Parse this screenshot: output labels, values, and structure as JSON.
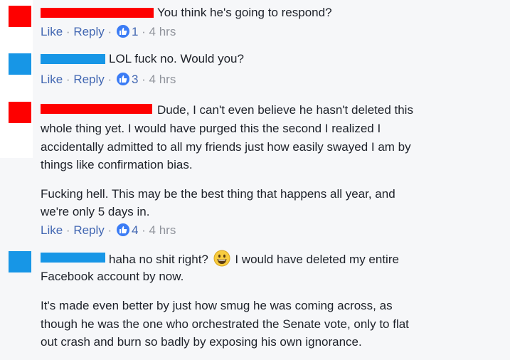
{
  "colors": {
    "red": "#fe0000",
    "blue": "#1796e6",
    "link": "#4267b2",
    "muted": "#90949c"
  },
  "comments": [
    {
      "avatar_color": "#fe0000",
      "text": "You think he's going to respond?",
      "like": "Like",
      "reply": "Reply",
      "sep": "·",
      "likes": "1",
      "time": "4 hrs"
    },
    {
      "avatar_color": "#1796e6",
      "text": "LOL fuck no. Would you?",
      "like": "Like",
      "reply": "Reply",
      "sep": "·",
      "likes": "3",
      "time": "4 hrs"
    },
    {
      "avatar_color": "#fe0000",
      "text_line1": "Dude, I can't even believe he hasn't deleted this",
      "text_line2": "whole thing yet. I would have purged this the second I realized I",
      "text_line3": "accidentally admitted to all my friends just how easily swayed I am by",
      "text_line4": "things like confirmation bias.",
      "para2_line1": "Fucking hell. This may be the best thing that happens all year, and",
      "para2_line2": "we're only 5 days in.",
      "like": "Like",
      "reply": "Reply",
      "sep": "·",
      "likes": "4",
      "time": "4 hrs"
    },
    {
      "avatar_color": "#1796e6",
      "text_before_emoji": "haha no shit right?",
      "emoji": "grinning-face-emoji",
      "text_after_emoji": "I would have deleted my entire",
      "text_line2": "Facebook account by now.",
      "para2_line1": "It's made even better by just how smug he was coming across, as",
      "para2_line2": "though he was the one who orchestrated the Senate vote, only to flat",
      "para2_line3": "out crash and burn so badly by exposing his own ignorance."
    }
  ]
}
